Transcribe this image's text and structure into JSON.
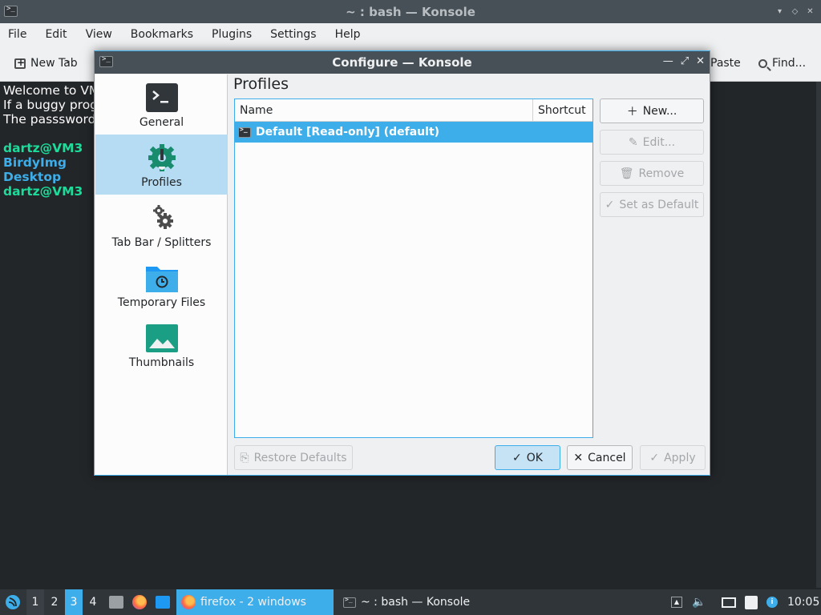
{
  "window": {
    "title": "~ : bash — Konsole",
    "menu": [
      "File",
      "Edit",
      "View",
      "Bookmarks",
      "Plugins",
      "Settings",
      "Help"
    ],
    "toolbar": {
      "new_tab": "New Tab",
      "paste": "Paste",
      "find": "Find..."
    }
  },
  "terminal": {
    "lines": [
      "Welcome to VM",
      "If a buggy prog",
      "The passsword"
    ],
    "prompt_lines": [
      "dartz@VM3",
      "BirdyImg",
      "Desktop",
      "dartz@VM3"
    ]
  },
  "dialog": {
    "title": "Configure — Konsole",
    "sidebar": [
      {
        "label": "General",
        "icon": "terminal-icon"
      },
      {
        "label": "Profiles",
        "icon": "profiles-gear-icon",
        "selected": true
      },
      {
        "label": "Tab Bar / Splitters",
        "icon": "gears-icon"
      },
      {
        "label": "Temporary Files",
        "icon": "folder-clock-icon"
      },
      {
        "label": "Thumbnails",
        "icon": "image-icon"
      }
    ],
    "page_title": "Profiles",
    "table": {
      "columns": [
        "Name",
        "Shortcut"
      ],
      "rows": [
        {
          "name": "Default [Read-only] (default)",
          "shortcut": ""
        }
      ]
    },
    "buttons": {
      "new": "New...",
      "edit": "Edit...",
      "remove": "Remove",
      "set_default": "Set as Default",
      "restore_defaults": "Restore Defaults",
      "ok": "OK",
      "cancel": "Cancel",
      "apply": "Apply"
    }
  },
  "taskbar": {
    "desktops": [
      "1",
      "2",
      "3",
      "4"
    ],
    "tasks": [
      {
        "label": "firefox - 2 windows",
        "active": true
      },
      {
        "label": "~ : bash — Konsole",
        "active": false
      }
    ],
    "clock": "10:05"
  },
  "colors": {
    "accent": "#3daee9",
    "selection": "#b5dcf3",
    "prompt_green": "#1cdc9a",
    "prompt_blue": "#3daee9",
    "terminal_bg": "#232629",
    "titlebar": "#475057"
  }
}
